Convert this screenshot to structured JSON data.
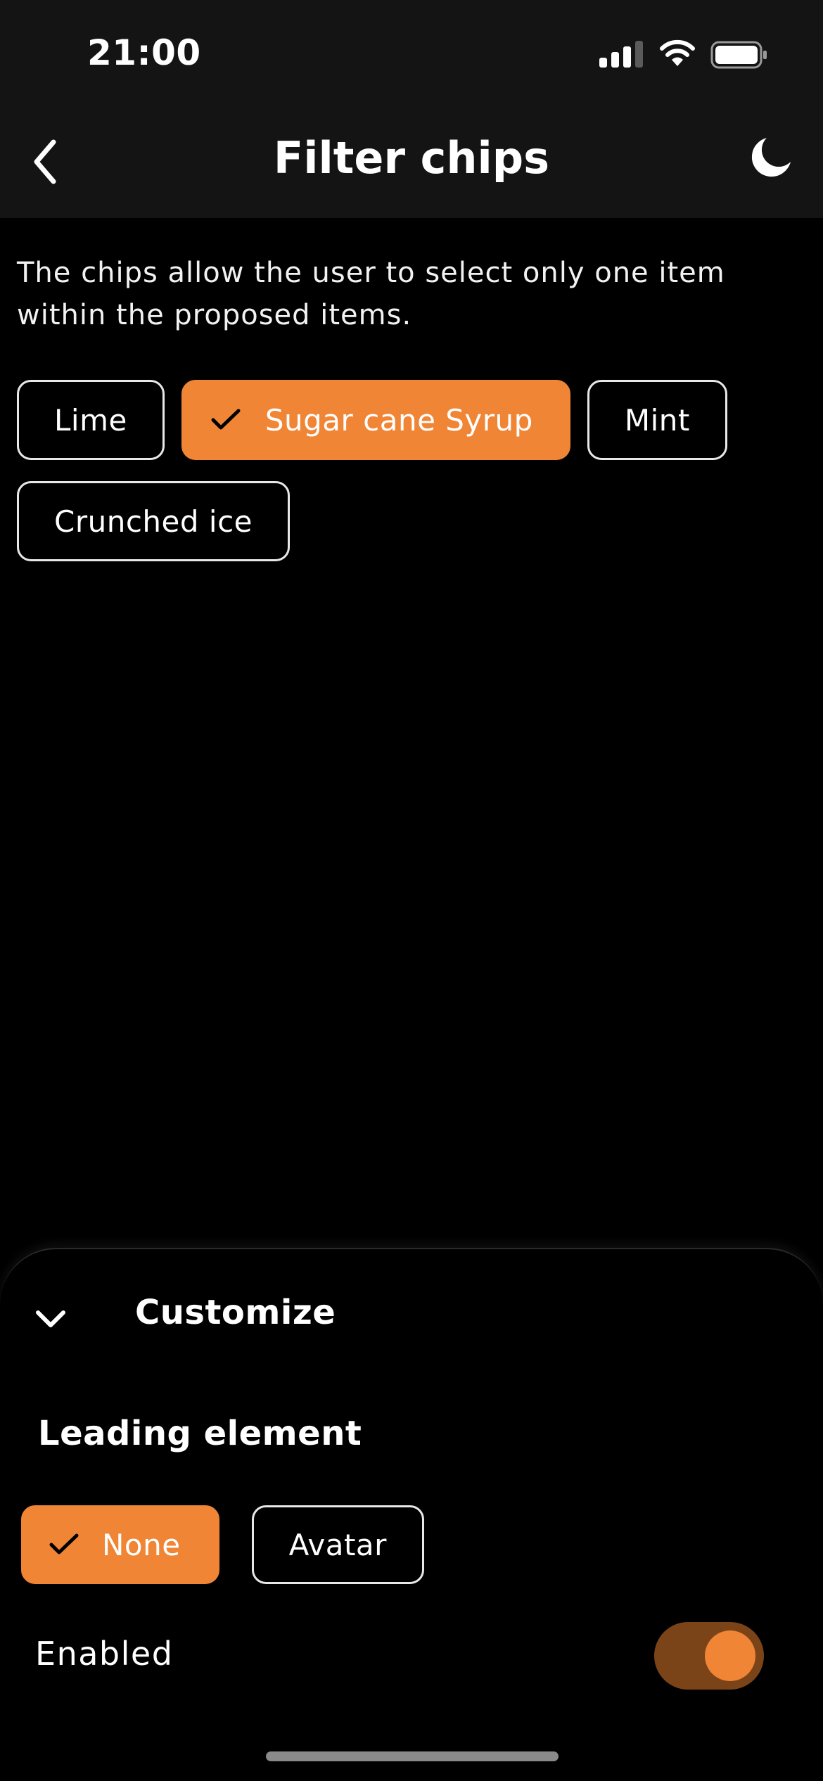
{
  "status_bar": {
    "time": "21:00",
    "icons": [
      "signal-icon",
      "wifi-icon",
      "battery-icon"
    ]
  },
  "app_bar": {
    "title": "Filter chips",
    "leading_icon": "back-icon",
    "trailing_icon": "moon-icon"
  },
  "content": {
    "description": "The chips allow the user to select only one item within the proposed items.",
    "chips": [
      {
        "label": "Lime",
        "selected": false
      },
      {
        "label": "Sugar cane Syrup",
        "selected": true
      },
      {
        "label": "Mint",
        "selected": false
      },
      {
        "label": "Crunched ice",
        "selected": false
      }
    ]
  },
  "sheet": {
    "title": "Customize",
    "expand_icon": "chevron-down-icon",
    "leading_element": {
      "title": "Leading element",
      "options": [
        {
          "label": "None",
          "selected": true
        },
        {
          "label": "Avatar",
          "selected": false
        }
      ]
    },
    "enabled": {
      "label": "Enabled",
      "value": true
    }
  },
  "colors": {
    "accent": "#ef8535",
    "toggle_track": "#7b4418",
    "background": "#000000",
    "app_bar": "#141414"
  }
}
